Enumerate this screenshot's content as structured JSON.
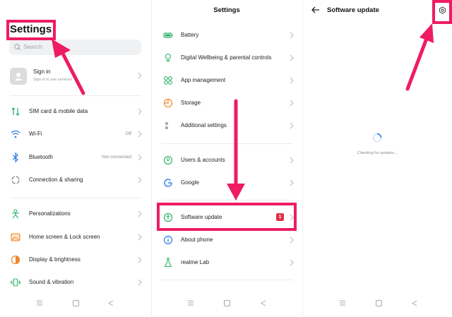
{
  "colors": {
    "accent": "#ee1c63",
    "badge": "#e0314a",
    "icon_green": "#2fb26a",
    "icon_blue": "#2b7de9",
    "icon_orange": "#f0862a"
  },
  "panel1": {
    "title": "Settings",
    "search_placeholder": "Search",
    "account": {
      "title": "Sign in",
      "subtitle": "Sign in to use services"
    },
    "items": [
      {
        "label": "SIM card & mobile data",
        "value": "",
        "icon": "sim-data-icon"
      },
      {
        "label": "Wi-Fi",
        "value": "Off",
        "icon": "wifi-icon"
      },
      {
        "label": "Bluetooth",
        "value": "Not connected",
        "icon": "bluetooth-icon"
      },
      {
        "label": "Connection & sharing",
        "value": "",
        "icon": "connection-icon"
      },
      {
        "label": "Personalizations",
        "value": "",
        "icon": "personalization-icon"
      },
      {
        "label": "Home screen & Lock screen",
        "value": "",
        "icon": "home-screen-icon"
      },
      {
        "label": "Display & brightness",
        "value": "",
        "icon": "display-icon"
      },
      {
        "label": "Sound & vibration",
        "value": "",
        "icon": "sound-icon"
      }
    ]
  },
  "panel2": {
    "title": "Settings",
    "items": [
      {
        "label": "Battery",
        "icon": "battery-icon"
      },
      {
        "label": "Digital Wellbeing & parental controls",
        "icon": "wellbeing-icon"
      },
      {
        "label": "App management",
        "icon": "app-management-icon"
      },
      {
        "label": "Storage",
        "icon": "storage-icon"
      },
      {
        "label": "Additional settings",
        "icon": "additional-settings-icon"
      },
      {
        "label": "Users & accounts",
        "icon": "users-icon"
      },
      {
        "label": "Google",
        "icon": "google-icon"
      },
      {
        "label": "Software update",
        "icon": "software-update-icon",
        "badge": "1"
      },
      {
        "label": "About phone",
        "icon": "about-phone-icon"
      },
      {
        "label": "realme Lab",
        "icon": "lab-icon"
      }
    ]
  },
  "panel3": {
    "title": "Software update",
    "status": "Checking for updates..."
  }
}
